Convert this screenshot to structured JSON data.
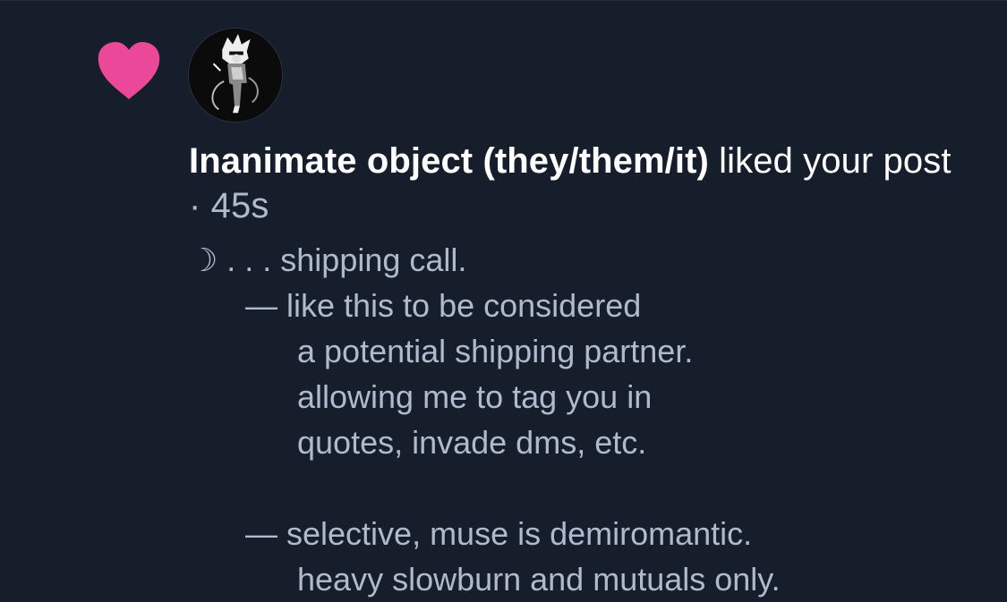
{
  "notification": {
    "type_icon": "heart-icon",
    "accent_color": "#ec4899",
    "user_name": "Inanimate object (they/them/it)",
    "action": "liked",
    "object": "your post",
    "separator": "·",
    "time_ago": "45s"
  },
  "post_preview": {
    "lines": [
      "☽ . . . shipping call.",
      "— like this to be considered",
      "a potential shipping partner.",
      "allowing me to tag you in",
      "quotes, invade dms, etc.",
      "",
      "— selective, muse is demiromantic.",
      "heavy slowburn and mutuals only."
    ]
  }
}
